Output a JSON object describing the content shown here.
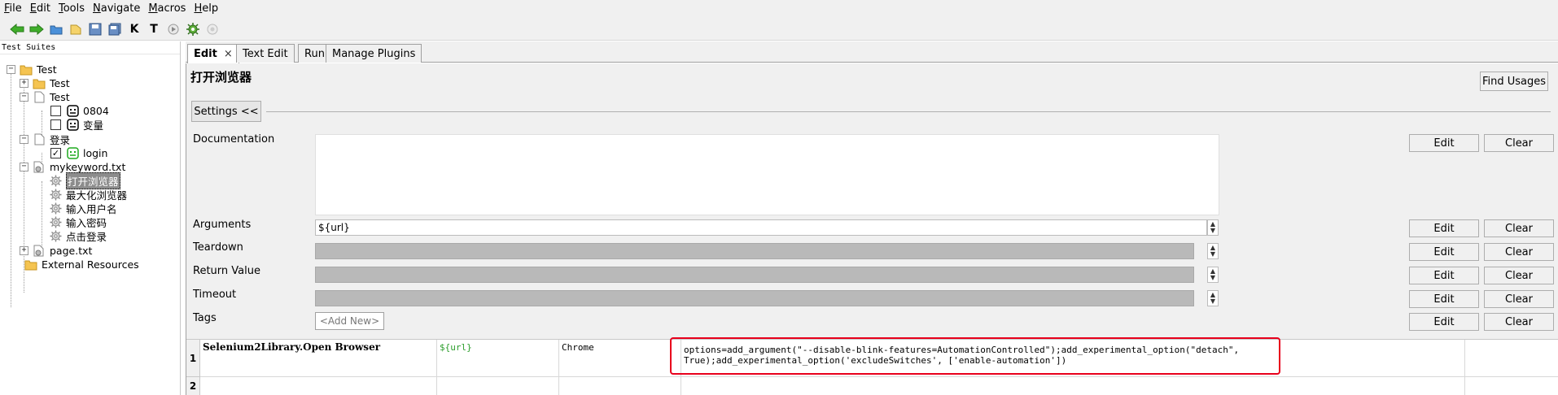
{
  "menu": [
    {
      "label": "File",
      "mnemonic": "F",
      "rest": "ile"
    },
    {
      "label": "Edit",
      "mnemonic": "E",
      "rest": "dit"
    },
    {
      "label": "Tools",
      "mnemonic": "T",
      "rest": "ools"
    },
    {
      "label": "Navigate",
      "mnemonic": "N",
      "rest": "avigate"
    },
    {
      "label": "Macros",
      "mnemonic": "M",
      "rest": "acros"
    },
    {
      "label": "Help",
      "mnemonic": "H",
      "rest": "elp"
    }
  ],
  "toolbar": {
    "icons": [
      "back-arrow-icon",
      "forward-arrow-icon",
      "open-folder-icon",
      "new-folder-icon",
      "save-icon",
      "save-all-icon",
      "keyword-search-icon",
      "test-search-icon",
      "run-icon",
      "settings-gear-icon",
      "stop-icon"
    ],
    "glyphs": {
      "k": "K",
      "t": "T"
    }
  },
  "tree": {
    "title": "Test Suites",
    "items": {
      "root": "Test",
      "test_folder": "Test",
      "test_file": "Test",
      "case_0804": "0804",
      "case_var": "变量",
      "login_file": "登录",
      "case_login": "login",
      "mykeyword": "mykeyword.txt",
      "kw_open": "打开浏览器",
      "kw_max": "最大化浏览器",
      "kw_user": "输入用户名",
      "kw_pwd": "输入密码",
      "kw_click": "点击登录",
      "page": "page.txt",
      "external": "External Resources"
    }
  },
  "tabs": {
    "edit": "Edit",
    "close": "×",
    "text_edit": "Text Edit",
    "run": "Run",
    "manage_plugins": "Manage Plugins"
  },
  "editor": {
    "keyword_title": "打开浏览器",
    "find_usages": "Find Usages",
    "settings_toggle": "Settings <<",
    "labels": {
      "documentation": "Documentation",
      "arguments": "Arguments",
      "teardown": "Teardown",
      "return_value": "Return Value",
      "timeout": "Timeout",
      "tags": "Tags"
    },
    "arguments_value": "${url}",
    "tags_placeholder": "<Add New>",
    "edit_label": "Edit",
    "clear_label": "Clear"
  },
  "grid": {
    "rows": [
      {
        "num": "1",
        "keyword": "Selenium2Library.Open Browser",
        "arg1": "${url}",
        "arg2": "Chrome",
        "arg3": "options=add_argument(\"--disable-blink-features=AutomationControlled\");add_experimental_option(\"detach\",\nTrue);add_experimental_option('excludeSwitches', ['enable-automation'])"
      },
      {
        "num": "2"
      }
    ]
  },
  "colors": {
    "highlight": "#e8001c",
    "variable": "#2a9d2a",
    "selection": "#8c8c8c"
  }
}
